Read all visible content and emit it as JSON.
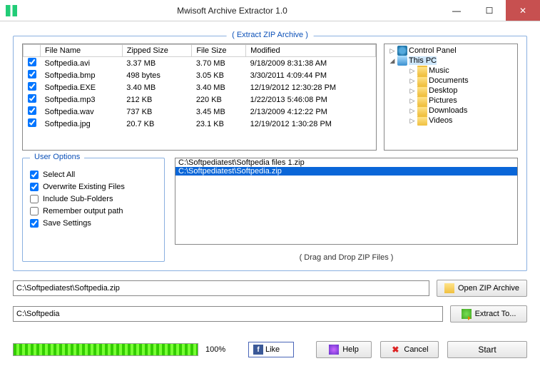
{
  "window": {
    "title": "Mwisoft Archive Extractor 1.0"
  },
  "group": {
    "title": "( Extract ZIP Archive )"
  },
  "table": {
    "headers": [
      "File Name",
      "Zipped Size",
      "File Size",
      "Modified"
    ],
    "rows": [
      {
        "checked": true,
        "name": "Softpedia.avi",
        "zipped": "3.37 MB",
        "size": "3.70 MB",
        "modified": "9/18/2009 8:31:38 AM"
      },
      {
        "checked": true,
        "name": "Softpedia.bmp",
        "zipped": "498 bytes",
        "size": "3.05 KB",
        "modified": "3/30/2011 4:09:44 PM"
      },
      {
        "checked": true,
        "name": "Softpedia.EXE",
        "zipped": "3.40 MB",
        "size": "3.40 MB",
        "modified": "12/19/2012 12:30:28 PM"
      },
      {
        "checked": true,
        "name": "Softpedia.mp3",
        "zipped": "212 KB",
        "size": "220 KB",
        "modified": "1/22/2013 5:46:08 PM"
      },
      {
        "checked": true,
        "name": "Softpedia.wav",
        "zipped": "737 KB",
        "size": "3.45 MB",
        "modified": "2/13/2009 4:12:22 PM"
      },
      {
        "checked": true,
        "name": "Softpedia.jpg",
        "zipped": "20.7 KB",
        "size": "23.1 KB",
        "modified": "12/19/2012 1:30:28 PM"
      }
    ]
  },
  "tree": {
    "root1": "Control Panel",
    "root2": "This PC",
    "folders": [
      "Music",
      "Documents",
      "Desktop",
      "Pictures",
      "Downloads",
      "Videos"
    ]
  },
  "userOptions": {
    "title": "User Options",
    "items": [
      {
        "label": "Select All",
        "checked": true
      },
      {
        "label": "Overwrite Existing Files",
        "checked": true
      },
      {
        "label": "Include Sub-Folders",
        "checked": false
      },
      {
        "label": "Remember output path",
        "checked": false
      },
      {
        "label": "Save  Settings",
        "checked": true
      }
    ]
  },
  "droplist": {
    "items": [
      {
        "text": "C:\\Softpediatest\\Softpedia files 1.zip",
        "selected": false
      },
      {
        "text": "C:\\Softpediatest\\Softpedia.zip",
        "selected": true
      }
    ],
    "hint": "( Drag  and Drop ZIP Files )"
  },
  "paths": {
    "zipPath": "C:\\Softpediatest\\Softpedia.zip",
    "outPath": "C:\\Softpedia"
  },
  "buttons": {
    "openZip": "Open ZIP Archive",
    "extractTo": "Extract To...",
    "like": "Like",
    "help": "Help",
    "cancel": "Cancel",
    "start": "Start"
  },
  "progress": {
    "percent": "100%"
  }
}
